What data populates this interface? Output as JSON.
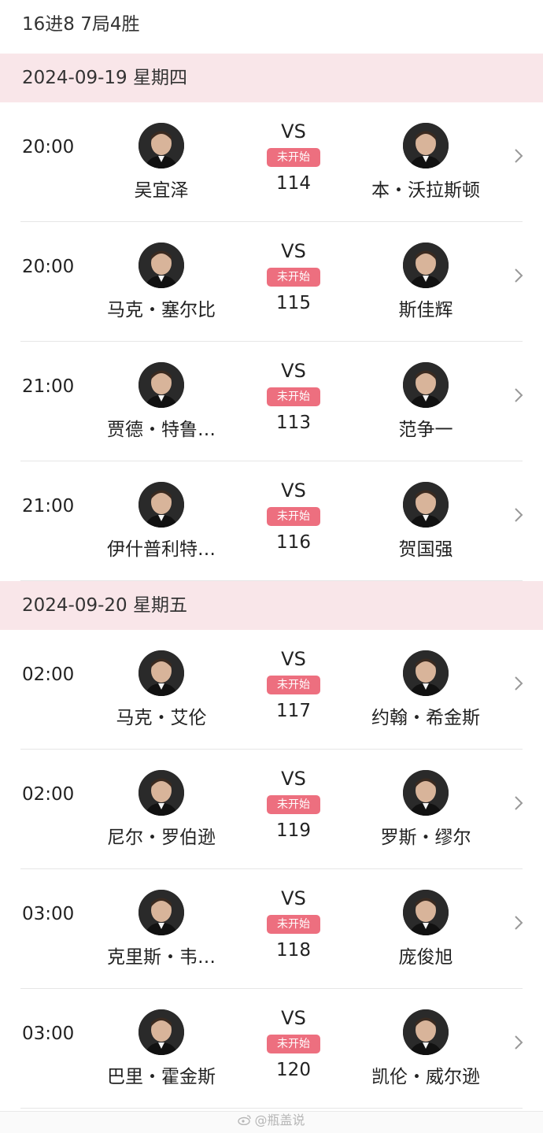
{
  "round_title": "16进8 7局4胜",
  "dates": [
    {
      "label": "2024-09-19 星期四",
      "matches": [
        {
          "time": "20:00",
          "p1": "吴宜泽",
          "p2": "本・沃拉斯顿",
          "vs": "VS",
          "status": "未开始",
          "code": "114"
        },
        {
          "time": "20:00",
          "p1": "马克・塞尔比",
          "p2": "斯佳辉",
          "vs": "VS",
          "status": "未开始",
          "code": "115"
        },
        {
          "time": "21:00",
          "p1": "贾德・特鲁…",
          "p2": "范争一",
          "vs": "VS",
          "status": "未开始",
          "code": "113"
        },
        {
          "time": "21:00",
          "p1": "伊什普利特…",
          "p2": "贺国强",
          "vs": "VS",
          "status": "未开始",
          "code": "116"
        }
      ]
    },
    {
      "label": "2024-09-20 星期五",
      "matches": [
        {
          "time": "02:00",
          "p1": "马克・艾伦",
          "p2": "约翰・希金斯",
          "vs": "VS",
          "status": "未开始",
          "code": "117"
        },
        {
          "time": "02:00",
          "p1": "尼尔・罗伯逊",
          "p2": "罗斯・缪尔",
          "vs": "VS",
          "status": "未开始",
          "code": "119"
        },
        {
          "time": "03:00",
          "p1": "克里斯・韦…",
          "p2": "庞俊旭",
          "vs": "VS",
          "status": "未开始",
          "code": "118"
        },
        {
          "time": "03:00",
          "p1": "巴里・霍金斯",
          "p2": "凯伦・威尔逊",
          "vs": "VS",
          "status": "未开始",
          "code": "120"
        }
      ]
    }
  ],
  "watermark": "@瓶盖说",
  "colors": {
    "date_bar": "#f9e6e9",
    "status_badge": "#ed6f7f",
    "divider": "#e6e6e6"
  },
  "icons": {
    "avatar": "player-avatar-icon",
    "chevron": "chevron-right-icon",
    "watermark": "weibo-icon"
  }
}
